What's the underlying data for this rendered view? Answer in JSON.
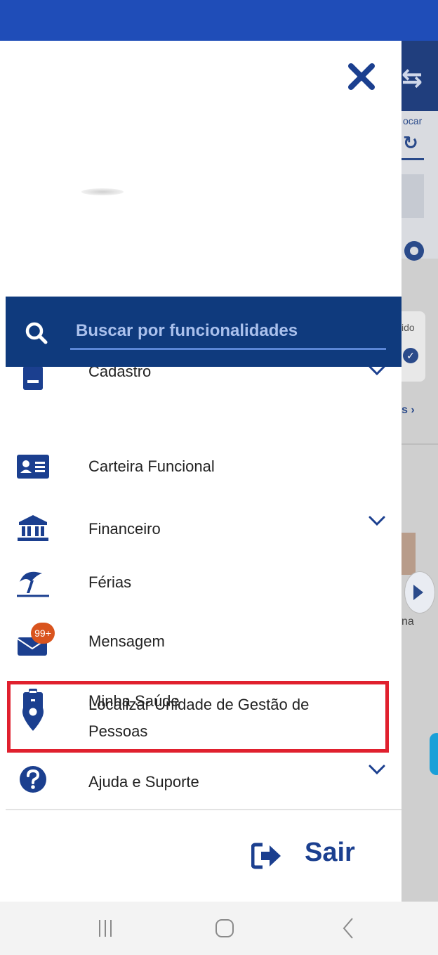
{
  "search": {
    "placeholder": "Buscar por funcionalidades"
  },
  "menu": {
    "items": [
      {
        "label": "Cadastro",
        "icon": "id-badge-icon",
        "has_chevron": true
      },
      {
        "label": "Carteira Funcional",
        "icon": "id-card-icon",
        "has_chevron": false
      },
      {
        "label": "Financeiro",
        "icon": "bank-icon",
        "has_chevron": true
      },
      {
        "label": "Férias",
        "icon": "beach-umbrella-icon",
        "has_chevron": false
      },
      {
        "label": "Mensagem",
        "icon": "envelope-icon",
        "has_chevron": false,
        "badge": "99+"
      },
      {
        "label": "Minha Saúde",
        "icon": "medical-clipboard-icon",
        "has_chevron": false
      },
      {
        "label": "Localizar Unidade de Gestão de Pessoas",
        "icon": "map-pin-icon",
        "has_chevron": false
      },
      {
        "label": "Ajuda e Suporte",
        "icon": "help-circle-icon",
        "has_chevron": true
      }
    ]
  },
  "logout": {
    "label": "Sair"
  },
  "background": {
    "trocar_fragment": "ocar",
    "ido_fragment": "ido",
    "more_fragment": "s",
    "na_fragment": "na"
  },
  "colors": {
    "brand_blue": "#1b3f8f",
    "search_bar": "#0f3a7d",
    "status_bar": "#1f4db8",
    "highlight": "#e0202e",
    "badge": "#d9541e"
  }
}
